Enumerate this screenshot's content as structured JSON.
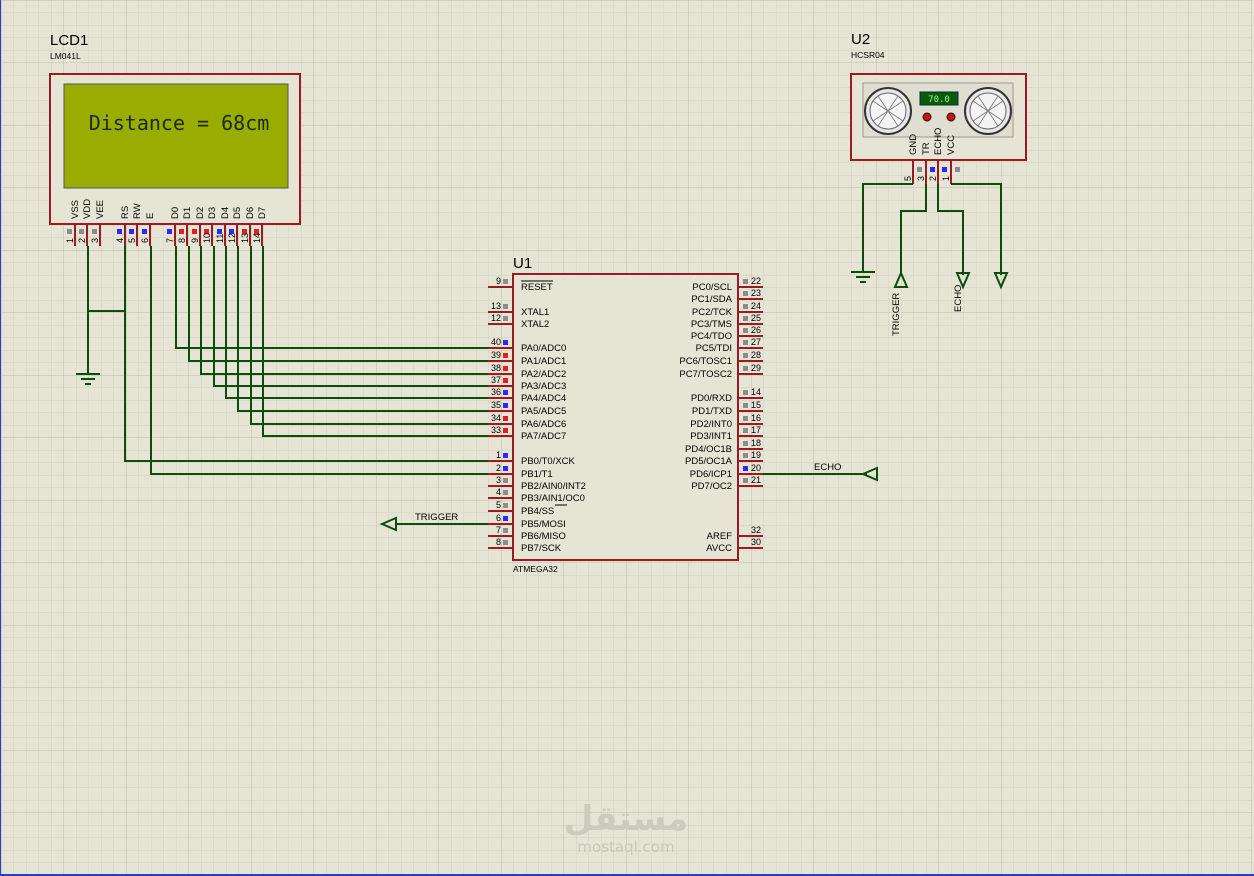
{
  "colors": {
    "background": "#e6e4d4",
    "grid_minor": "#d2d0bf",
    "grid_major": "#bebcaa",
    "component_border": "#9b1c20",
    "component_fill": "#e6e4d4",
    "wire": "#0b4d0b",
    "lcd_screen": "#98ad00",
    "pin_blue": "#2a2aff",
    "pin_red": "#e02020",
    "pin_gray": "#8c8c8c"
  },
  "lcd": {
    "ref": "LCD1",
    "part": "LM041L",
    "display_text": "Distance = 68cm",
    "pins": [
      {
        "name": "VSS",
        "num": "1",
        "state": "gray"
      },
      {
        "name": "VDD",
        "num": "2",
        "state": "gray"
      },
      {
        "name": "VEE",
        "num": "3",
        "state": "gray"
      },
      {
        "name": "RS",
        "num": "4",
        "state": "blue"
      },
      {
        "name": "RW",
        "num": "5",
        "state": "blue"
      },
      {
        "name": "E",
        "num": "6",
        "state": "blue"
      },
      {
        "name": "D0",
        "num": "7",
        "state": "blue"
      },
      {
        "name": "D1",
        "num": "8",
        "state": "red"
      },
      {
        "name": "D2",
        "num": "9",
        "state": "red"
      },
      {
        "name": "D3",
        "num": "10",
        "state": "red"
      },
      {
        "name": "D4",
        "num": "11",
        "state": "blue"
      },
      {
        "name": "D5",
        "num": "12",
        "state": "blue"
      },
      {
        "name": "D6",
        "num": "13",
        "state": "red"
      },
      {
        "name": "D7",
        "num": "14",
        "state": "red"
      }
    ]
  },
  "mcu": {
    "ref": "U1",
    "part": "ATMEGA32",
    "left_pins": [
      {
        "num": "9",
        "name": "RESET",
        "state": "gray",
        "overline": true
      },
      {
        "num": "13",
        "name": "XTAL1",
        "state": "gray"
      },
      {
        "num": "12",
        "name": "XTAL2",
        "state": "gray"
      },
      {
        "num": "40",
        "name": "PA0/ADC0",
        "state": "blue"
      },
      {
        "num": "39",
        "name": "PA1/ADC1",
        "state": "red"
      },
      {
        "num": "38",
        "name": "PA2/ADC2",
        "state": "red"
      },
      {
        "num": "37",
        "name": "PA3/ADC3",
        "state": "red"
      },
      {
        "num": "36",
        "name": "PA4/ADC4",
        "state": "blue"
      },
      {
        "num": "35",
        "name": "PA5/ADC5",
        "state": "blue"
      },
      {
        "num": "34",
        "name": "PA6/ADC6",
        "state": "red"
      },
      {
        "num": "33",
        "name": "PA7/ADC7",
        "state": "red"
      },
      {
        "num": "1",
        "name": "PB0/T0/XCK",
        "state": "blue"
      },
      {
        "num": "2",
        "name": "PB1/T1",
        "state": "blue"
      },
      {
        "num": "3",
        "name": "PB2/AIN0/INT2",
        "state": "gray"
      },
      {
        "num": "4",
        "name": "PB3/AIN1/OC0",
        "state": "gray"
      },
      {
        "num": "5",
        "name": "PB4/SS",
        "state": "gray",
        "overline_part": "SS"
      },
      {
        "num": "6",
        "name": "PB5/MOSI",
        "state": "blue"
      },
      {
        "num": "7",
        "name": "PB6/MISO",
        "state": "gray"
      },
      {
        "num": "8",
        "name": "PB7/SCK",
        "state": "gray"
      }
    ],
    "right_pins": [
      {
        "num": "22",
        "name": "PC0/SCL",
        "state": "gray"
      },
      {
        "num": "23",
        "name": "PC1/SDA",
        "state": "gray"
      },
      {
        "num": "24",
        "name": "PC2/TCK",
        "state": "gray"
      },
      {
        "num": "25",
        "name": "PC3/TMS",
        "state": "gray"
      },
      {
        "num": "26",
        "name": "PC4/TDO",
        "state": "gray"
      },
      {
        "num": "27",
        "name": "PC5/TDI",
        "state": "gray"
      },
      {
        "num": "28",
        "name": "PC6/TOSC1",
        "state": "gray"
      },
      {
        "num": "29",
        "name": "PC7/TOSC2",
        "state": "gray"
      },
      {
        "num": "14",
        "name": "PD0/RXD",
        "state": "gray"
      },
      {
        "num": "15",
        "name": "PD1/TXD",
        "state": "gray"
      },
      {
        "num": "16",
        "name": "PD2/INT0",
        "state": "gray"
      },
      {
        "num": "17",
        "name": "PD3/INT1",
        "state": "gray"
      },
      {
        "num": "18",
        "name": "PD4/OC1B",
        "state": "gray"
      },
      {
        "num": "19",
        "name": "PD5/OC1A",
        "state": "gray"
      },
      {
        "num": "20",
        "name": "PD6/ICP1",
        "state": "blue"
      },
      {
        "num": "21",
        "name": "PD7/OC2",
        "state": "gray"
      },
      {
        "num": "32",
        "name": "AREF",
        "state": "none"
      },
      {
        "num": "30",
        "name": "AVCC",
        "state": "none"
      }
    ]
  },
  "sensor": {
    "ref": "U2",
    "part": "HCSR04",
    "display_value": "70.0",
    "pins": [
      {
        "name": "GND",
        "num": "5",
        "state": "gray"
      },
      {
        "name": "TR",
        "num": "3",
        "state": "blue"
      },
      {
        "name": "ECHO",
        "num": "2",
        "state": "blue"
      },
      {
        "name": "VCC",
        "num": "1",
        "state": "gray"
      }
    ]
  },
  "net_labels": {
    "trigger_mcu": "TRIGGER",
    "echo_mcu": "ECHO",
    "trigger_sensor": "TRIGGER",
    "echo_sensor": "ECHO"
  },
  "watermark": {
    "arabic": "مستقل",
    "latin": "mostaql.com"
  }
}
